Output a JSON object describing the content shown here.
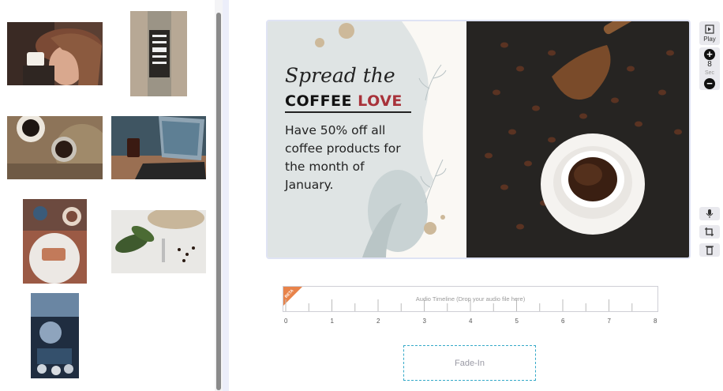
{
  "gallery": {
    "items": [
      {
        "name": "woman-drinking-coffee"
      },
      {
        "name": "coffee-bottle-sticker"
      },
      {
        "name": "coffee-cups-on-table"
      },
      {
        "name": "laptop-and-drink"
      },
      {
        "name": "cake-and-coffee"
      },
      {
        "name": "coffee-beans-and-plant"
      },
      {
        "name": "collage-image"
      }
    ]
  },
  "ad": {
    "headline_script": "Spread the",
    "headline_coffee": "COFFEE",
    "headline_love": "LOVE",
    "body": [
      "Have 50% off all",
      "coffee products for",
      "the month of",
      "January."
    ]
  },
  "toolbar": {
    "play_label": "Play",
    "seconds_value": "8",
    "seconds_unit": "Sec",
    "icons": [
      "play-icon",
      "plus-icon",
      "minus-icon",
      "mic-icon",
      "crop-icon",
      "trash-icon"
    ]
  },
  "audio_timeline": {
    "badge": "BETA",
    "placeholder": "Audio Timeline (Drop your audio file here)",
    "ticks": [
      "0",
      "1",
      "2",
      "3",
      "4",
      "5",
      "6",
      "7",
      "8"
    ]
  },
  "animation": {
    "label": "Fade-In"
  },
  "colors": {
    "accent_love": "#a8323a",
    "beta_badge": "#e8834a",
    "fade_border": "#35a9c8"
  }
}
